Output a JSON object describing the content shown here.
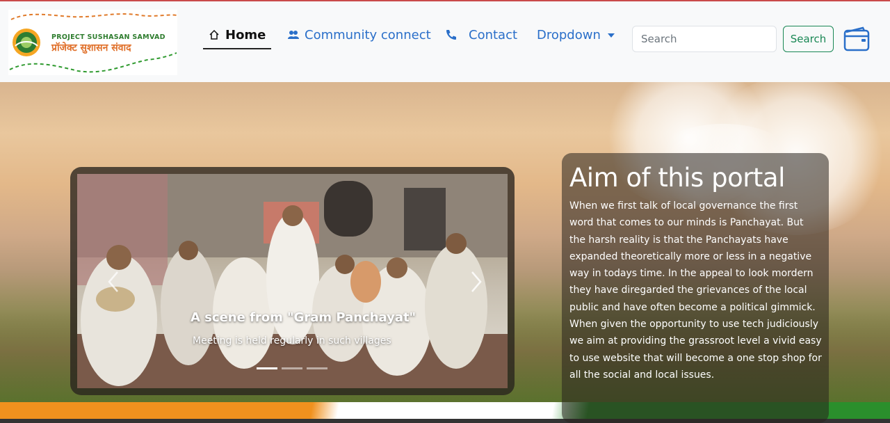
{
  "logo": {
    "text_en": "PROJECT SUSHASAN SAMVAD",
    "text_hi": "प्रॉजेक्ट सुशासन संवाद"
  },
  "nav": {
    "items": [
      {
        "label": "Home",
        "icon": "home-icon",
        "active": true
      },
      {
        "label": "Community connect",
        "icon": "people-icon",
        "active": false
      },
      {
        "label": "Contact",
        "icon": "phone-icon",
        "active": false
      },
      {
        "label": "Dropdown",
        "icon": "caret-down-icon",
        "active": false
      }
    ]
  },
  "search": {
    "placeholder": "Search",
    "button_label": "Search"
  },
  "wallet_icon": "wallet-icon",
  "carousel": {
    "caption_title": "A scene from \"Gram Panchayat\"",
    "caption_subtitle": "Meeting is held regularly in such villages",
    "slide_count": 3,
    "active_slide": 1
  },
  "aim": {
    "title": "Aim of this portal",
    "body": "When we first talk of local governance the first word that comes to our minds is Panchayat. But the harsh reality is that the Panchayats have expanded theoretically more or less in a negative way in todays time. In the appeal to look mordern they have diregarded the grievances of the local public and have often become a political gimmick. When given the opportunity to use tech judiciously we aim at providing the grassroot level a vivid easy to use website that will become a one stop shop for all the social and local issues."
  },
  "colors": {
    "nav_link": "#2a6fc9",
    "search_button": "#198754",
    "saffron": "#f0911e",
    "green": "#2a8f2c"
  }
}
